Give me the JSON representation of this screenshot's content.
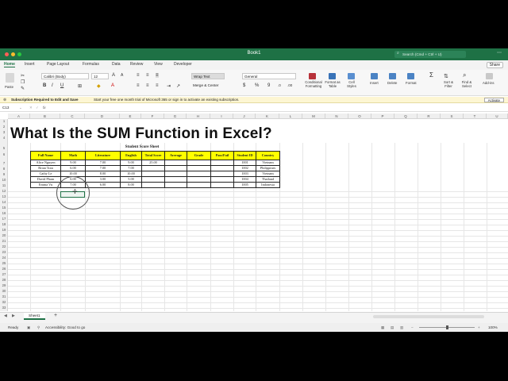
{
  "titlebar": {
    "title": "Book1",
    "search_placeholder": "Search (Cmd + Ctrl + U)"
  },
  "tabs": [
    "Home",
    "Insert",
    "Page Layout",
    "Formulas",
    "Data",
    "Review",
    "View",
    "Developer"
  ],
  "share_label": "Share",
  "ribbon": {
    "paste": "Paste",
    "font_name": "Calibri (Body)",
    "font_size": "12",
    "wrap_text": "Wrap Text",
    "merge_center": "Merge & Center",
    "number_format": "General",
    "conditional_formatting": "Conditional Formatting",
    "format_as_table": "Format as Table",
    "cell_styles": "Cell Styles",
    "insert": "Insert",
    "delete": "Delete",
    "format": "Format",
    "sort_filter": "Sort & Filter",
    "find_select": "Find & Select",
    "add_ins": "Add-ins"
  },
  "subscription": {
    "title": "Subscription Required to Edit and Save",
    "message": "Start your free one month trial of Microsoft 365 or sign in to activate an existing subscription.",
    "button": "Activate"
  },
  "formula_bar": {
    "name_box": "C13",
    "fx": "fx"
  },
  "columns": [
    "A",
    "B",
    "C",
    "D",
    "E",
    "F",
    "G",
    "H",
    "I",
    "J",
    "K",
    "L",
    "M",
    "N",
    "O",
    "P",
    "Q",
    "R",
    "S",
    "T",
    "U"
  ],
  "rows": [
    "1",
    "2",
    "3",
    "4",
    "5",
    "6",
    "7",
    "8",
    "9",
    "10",
    "11",
    "12",
    "13",
    "14",
    "15",
    "16",
    "17",
    "18",
    "19",
    "20",
    "21",
    "22",
    "23",
    "24",
    "25",
    "26",
    "27",
    "28",
    "29",
    "30",
    "31",
    "32",
    "33",
    "34",
    "35"
  ],
  "overlay_heading": "What Is the SUM Function in Excel?",
  "sheet_title": "Student Score Sheet",
  "table": {
    "headers": [
      "Full Name",
      "Math",
      "Literature",
      "English",
      "Total Score",
      "Average",
      "Grade",
      "Pass/Fail",
      "Student ID",
      "Country"
    ],
    "rows": [
      [
        "Alice Nguyen",
        "9.00",
        "7.00",
        "9.00",
        "25.00",
        "",
        "",
        "",
        "1001",
        "Vietnam"
      ],
      [
        "Brian Tran",
        "6.00",
        "7.00",
        "7.00",
        "",
        "",
        "",
        "",
        "1002",
        "Philippines"
      ],
      [
        "Cathy Le",
        "10.00",
        "8.00",
        "10.00",
        "",
        "",
        "",
        "",
        "1003",
        "Vietnam"
      ],
      [
        "David Pham",
        "6.00",
        "3.00",
        "5.00",
        "",
        "",
        "",
        "",
        "1004",
        "Thailand"
      ],
      [
        "Emma Vu",
        "7.00",
        "6.00",
        "8.00",
        "",
        "",
        "",
        "",
        "1005",
        "Indonesia"
      ]
    ]
  },
  "sheet_tab": "Sheet1",
  "status": {
    "ready": "Ready",
    "accessibility": "Accessibility: Good to go",
    "zoom": "100%"
  },
  "colors": {
    "excel_green": "#1e7145",
    "header_yellow": "#ffff00"
  }
}
